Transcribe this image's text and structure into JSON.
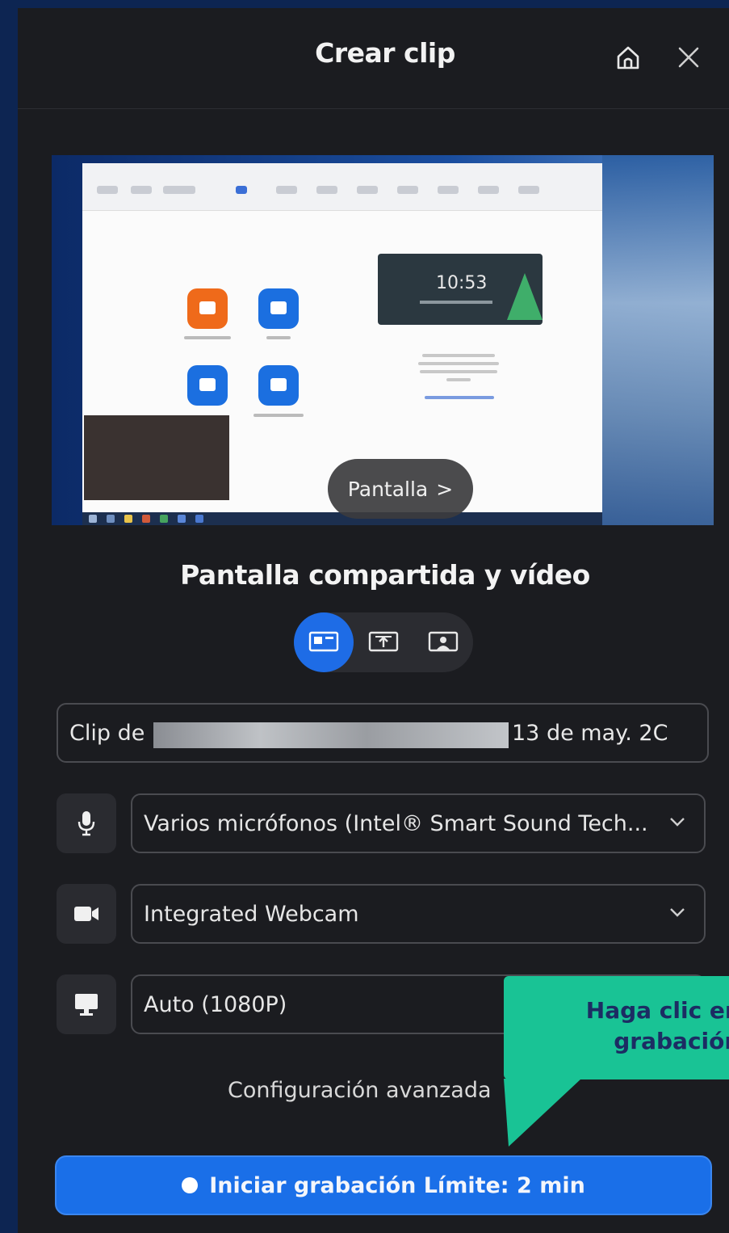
{
  "header": {
    "title": "Crear clip",
    "home_icon": "home-icon",
    "close_icon": "close-icon"
  },
  "preview": {
    "source_button_label": "Pantalla",
    "source_chevron": ">",
    "clock_time": "10:53"
  },
  "layout": {
    "label": "Pantalla compartida y vídeo",
    "options": [
      {
        "icon": "screen-and-video-icon",
        "selected": true
      },
      {
        "icon": "screen-only-icon",
        "selected": false
      },
      {
        "icon": "video-only-icon",
        "selected": false
      }
    ]
  },
  "clip_name": {
    "prefix": "Clip de",
    "date": "13 de may. 2C"
  },
  "devices": {
    "microphone": {
      "icon": "microphone-icon",
      "value": "Varios micrófonos (Intel® Smart Sound Tech..."
    },
    "camera": {
      "icon": "camera-icon",
      "value": "Integrated Webcam"
    },
    "resolution": {
      "icon": "monitor-icon",
      "value": "Auto (1080P)"
    }
  },
  "advanced_label": "Configuración avanzada",
  "record_button": {
    "label": "Iniciar grabación Límite: 2 min"
  },
  "callout": {
    "line1": "Haga clic en “Ir",
    "line2": "grabación”",
    "color": "#19c395"
  },
  "colors": {
    "accent": "#1e6ce6",
    "panel": "#1b1c20",
    "background": "#0d2552"
  }
}
